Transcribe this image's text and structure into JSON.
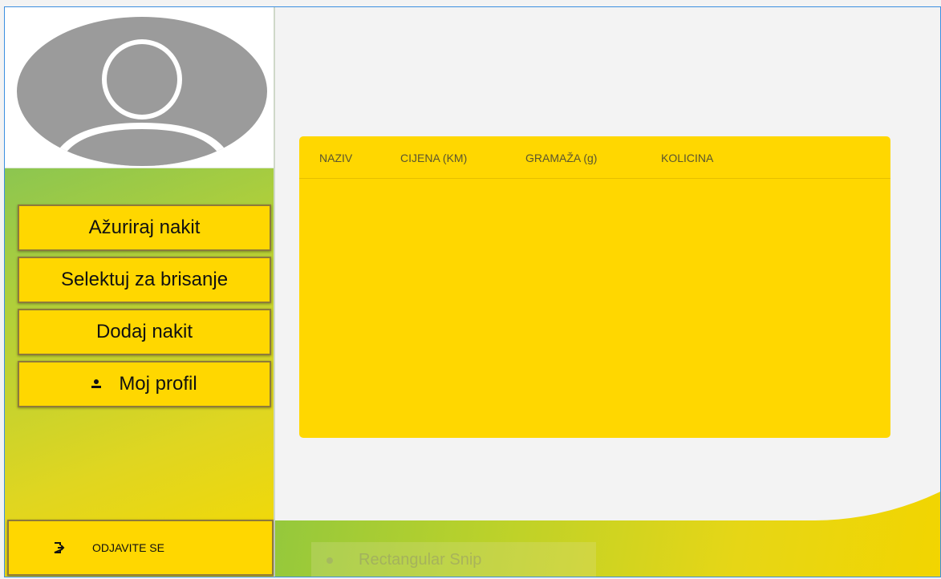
{
  "sidebar": {
    "buttons": {
      "update": "Ažuriraj nakit",
      "select_delete": "Selektuj za brisanje",
      "add": "Dodaj nakit",
      "profile": "Moj profil"
    },
    "logout": "ODJAVITE SE",
    "icons": {
      "profile": "person-icon",
      "logout": "logout-icon",
      "avatar": "user-silhouette"
    }
  },
  "table": {
    "columns": [
      "NAZIV",
      "CIJENA (KM)",
      "GRAMAŽA (g)",
      "KOLICINA"
    ],
    "rows": []
  },
  "overlay": {
    "label": "Rectangular Snip"
  },
  "colors": {
    "accent": "#ffd700",
    "window_border": "#3c8fe0",
    "panel_bg": "#f3f3f3"
  }
}
